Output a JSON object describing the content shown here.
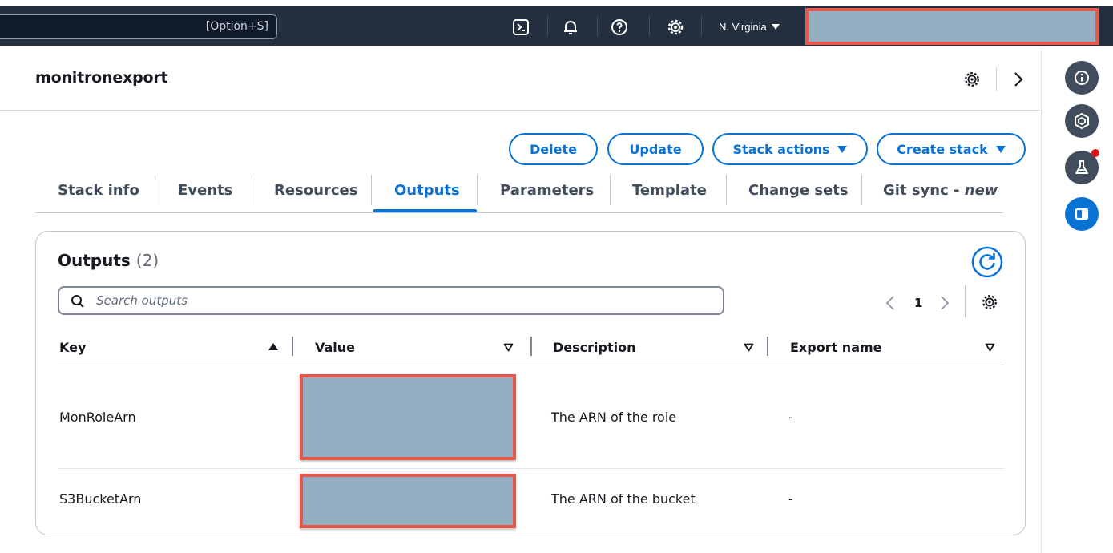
{
  "topnav": {
    "search_hint": "[Option+S]",
    "icons": [
      "cloudshell-icon",
      "bell-icon",
      "help-icon",
      "settings-icon"
    ],
    "region": "N. Virginia"
  },
  "header": {
    "title": "monitronexport"
  },
  "actions": {
    "delete": "Delete",
    "update": "Update",
    "stack_actions": "Stack actions",
    "create_stack": "Create stack"
  },
  "tabs": [
    {
      "label": "Stack info"
    },
    {
      "label": "Events"
    },
    {
      "label": "Resources"
    },
    {
      "label": "Outputs",
      "active": true
    },
    {
      "label": "Parameters"
    },
    {
      "label": "Template"
    },
    {
      "label": "Change sets"
    },
    {
      "label": "Git sync - ",
      "badge": "new"
    }
  ],
  "outputs": {
    "title": "Outputs",
    "count": "(2)",
    "search_placeholder": "Search outputs",
    "page": "1",
    "columns": [
      "Key",
      "Value",
      "Description",
      "Export name"
    ],
    "rows": [
      {
        "key": "MonRoleArn",
        "value": "",
        "description": "The ARN of the role",
        "export_name": "-"
      },
      {
        "key": "S3BucketArn",
        "value": "",
        "description": "The ARN of the bucket",
        "export_name": "-"
      }
    ]
  },
  "rail": {
    "icons": [
      "info-icon",
      "hexagon-icon",
      "flask-icon",
      "panel-icon"
    ]
  },
  "colors": {
    "nav_bg": "#232f3e",
    "accent": "#0972d3",
    "redaction_fill": "#93afc1",
    "redaction_border": "#e8574b"
  }
}
